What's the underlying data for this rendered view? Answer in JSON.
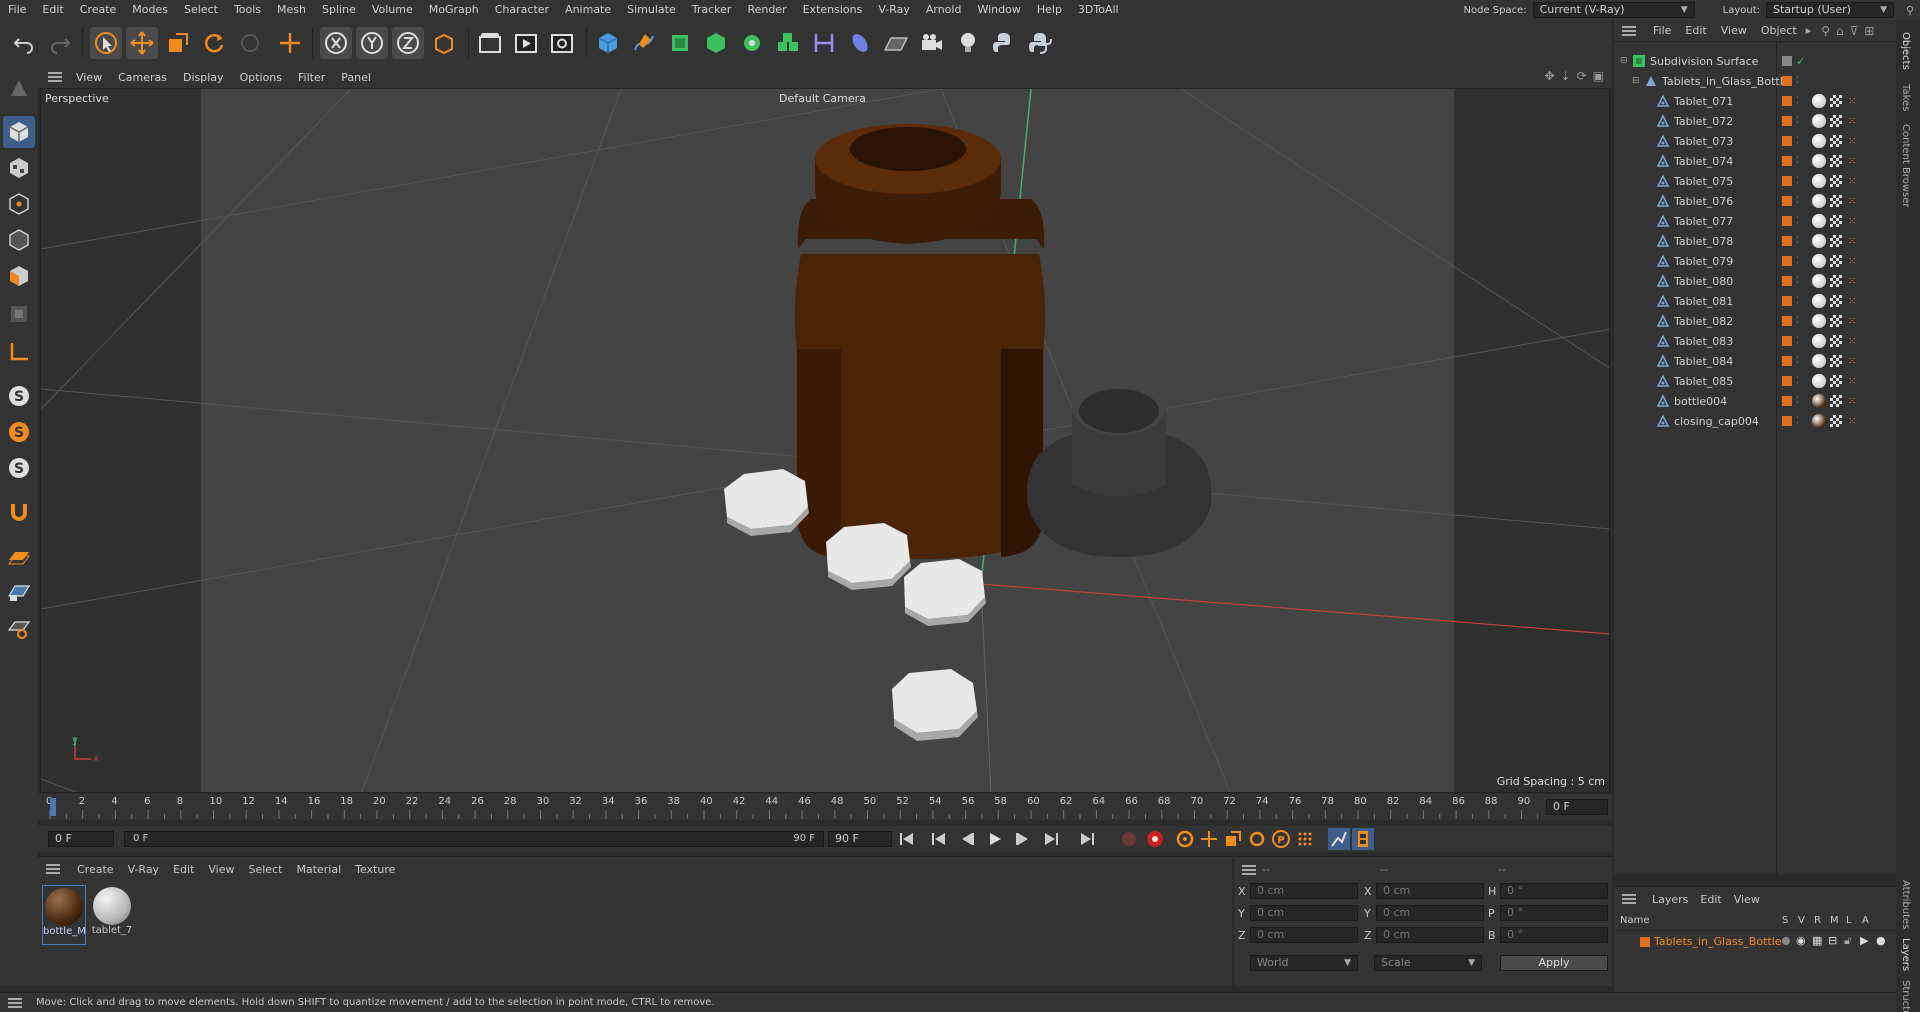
{
  "menubar": {
    "items": [
      "File",
      "Edit",
      "Create",
      "Modes",
      "Select",
      "Tools",
      "Mesh",
      "Spline",
      "Volume",
      "MoGraph",
      "Character",
      "Animate",
      "Simulate",
      "Tracker",
      "Render",
      "Extensions",
      "V-Ray",
      "Arnold",
      "Window",
      "Help",
      "3DToAll"
    ],
    "node_space_label": "Node Space:",
    "node_space_value": "Current (V-Ray)",
    "layout_label": "Layout:",
    "layout_value": "Startup (User)"
  },
  "viewport": {
    "menu": [
      "View",
      "Cameras",
      "Display",
      "Options",
      "Filter",
      "Panel"
    ],
    "label": "Perspective",
    "camera": "Default Camera",
    "grid_spacing": "Grid Spacing : 5 cm",
    "axis_y": "y",
    "axis_x": "x"
  },
  "timeline": {
    "ticks": [
      "0",
      "2",
      "4",
      "6",
      "8",
      "10",
      "12",
      "14",
      "16",
      "18",
      "20",
      "22",
      "24",
      "26",
      "28",
      "30",
      "32",
      "34",
      "36",
      "38",
      "40",
      "42",
      "44",
      "46",
      "48",
      "50",
      "52",
      "54",
      "56",
      "58",
      "60",
      "62",
      "64",
      "66",
      "68",
      "70",
      "72",
      "74",
      "76",
      "78",
      "80",
      "82",
      "84",
      "86",
      "88",
      "90"
    ],
    "current_frame": "0 F",
    "start": "0 F",
    "range_start": "0 F",
    "range_end": "90 F",
    "end": "90 F"
  },
  "material_manager": {
    "menu": [
      "Create",
      "V-Ray",
      "Edit",
      "View",
      "Select",
      "Material",
      "Texture"
    ],
    "materials": [
      {
        "name": "bottle_M",
        "color": "#4a2a10"
      },
      {
        "name": "tablet_7",
        "color": "#bcbcbc"
      }
    ]
  },
  "attribute_manager": {
    "headers": [
      "--",
      "--",
      "--"
    ],
    "rows": [
      {
        "a": "X",
        "av": "0 cm",
        "b": "X",
        "bv": "0 cm",
        "c": "H",
        "cv": "0 °"
      },
      {
        "a": "Y",
        "av": "0 cm",
        "b": "Y",
        "bv": "0 cm",
        "c": "P",
        "cv": "0 °"
      },
      {
        "a": "Z",
        "av": "0 cm",
        "b": "Z",
        "bv": "0 cm",
        "c": "B",
        "cv": "0 °"
      }
    ],
    "coord_mode": "World",
    "size_mode": "Scale",
    "apply": "Apply"
  },
  "object_manager": {
    "menu": [
      "File",
      "Edit",
      "View",
      "Object"
    ],
    "root": "Subdivision Surface",
    "group": "Tablets_in_Glass_Bottle",
    "objects": [
      "Tablet_071",
      "Tablet_072",
      "Tablet_073",
      "Tablet_074",
      "Tablet_075",
      "Tablet_076",
      "Tablet_077",
      "Tablet_078",
      "Tablet_079",
      "Tablet_080",
      "Tablet_081",
      "Tablet_082",
      "Tablet_083",
      "Tablet_084",
      "Tablet_085",
      "bottle004",
      "closing_cap004"
    ]
  },
  "layers": {
    "menu": [
      "Layers",
      "Edit",
      "View"
    ],
    "columns": [
      "Name",
      "S",
      "V",
      "R",
      "M",
      "L",
      "A"
    ],
    "layer_name": "Tablets_in_Glass_Bottle",
    "layer_color": "#e07020"
  },
  "right_tabs": [
    "Objects",
    "Takes",
    "Content Browser",
    "Attributes",
    "Layers",
    "Structure"
  ],
  "status": "Move: Click and drag to move elements. Hold down SHIFT to quantize movement / add to the selection in point mode, CTRL to remove.",
  "colors": {
    "accent": "#f08c1e",
    "select_blue": "#3f5f8a",
    "tag_orange": "#e07020"
  }
}
